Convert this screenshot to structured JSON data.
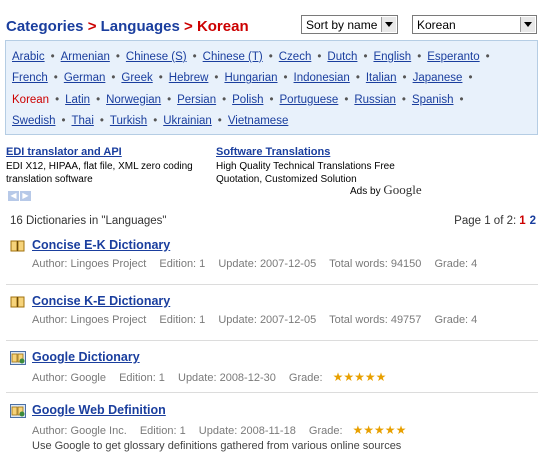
{
  "breadcrumb": {
    "items": [
      "Categories",
      "Languages",
      "Korean"
    ],
    "separator": ">"
  },
  "sort_select": {
    "value": "Sort by name"
  },
  "language_select": {
    "value": "Korean"
  },
  "languages": [
    "Arabic",
    "Armenian",
    "Chinese (S)",
    "Chinese (T)",
    "Czech",
    "Dutch",
    "English",
    "Esperanto",
    "French",
    "German",
    "Greek",
    "Hebrew",
    "Hungarian",
    "Indonesian",
    "Italian",
    "Japanese",
    "Korean",
    "Latin",
    "Norwegian",
    "Persian",
    "Polish",
    "Portuguese",
    "Russian",
    "Spanish",
    "Swedish",
    "Thai",
    "Turkish",
    "Ukrainian",
    "Vietnamese"
  ],
  "active_language": "Korean",
  "ads": [
    {
      "title": "EDI translator and API",
      "text": "EDI X12, HIPAA, flat file, XML zero coding translation software"
    },
    {
      "title": "Software Translations",
      "text": "High Quality Technical Translations Free Quotation, Customized Solution"
    }
  ],
  "ads_by": {
    "label": "Ads by",
    "brand": "Google"
  },
  "listing": {
    "count_text": "16 Dictionaries in \"Languages\"",
    "page_text": "Page 1 of 2:",
    "pages": [
      "1",
      "2"
    ],
    "current_page": "1"
  },
  "entries": [
    {
      "title": "Concise E-K Dictionary",
      "icon": "book-icon",
      "author": "Author: Lingoes Project",
      "edition": "Edition: 1",
      "update": "Update: 2007-12-05",
      "words": "Total words: 94150",
      "grade": "Grade: 4"
    },
    {
      "title": "Concise K-E Dictionary",
      "icon": "book-icon",
      "author": "Author: Lingoes Project",
      "edition": "Edition: 1",
      "update": "Update: 2007-12-05",
      "words": "Total words: 49757",
      "grade": "Grade: 4"
    },
    {
      "title": "Google Dictionary",
      "icon": "online-dictionary-icon",
      "author": "Author: Google",
      "edition": "Edition: 1",
      "update": "Update: 2008-12-30",
      "grade": "Grade:",
      "stars": "★★★★★",
      "rating": 5
    },
    {
      "title": "Google Web Definition",
      "icon": "online-dictionary-icon",
      "author": "Author: Google Inc.",
      "edition": "Edition: 1",
      "update": "Update: 2008-11-18",
      "grade": "Grade:",
      "stars": "★★★★★",
      "rating": 5,
      "description": "Use Google to get glossary definitions gathered from various online sources"
    }
  ],
  "colors": {
    "link": "#1a3e9e",
    "active": "#cc0000",
    "box_bg": "#e8f1fb",
    "stars": "#e8a000"
  }
}
